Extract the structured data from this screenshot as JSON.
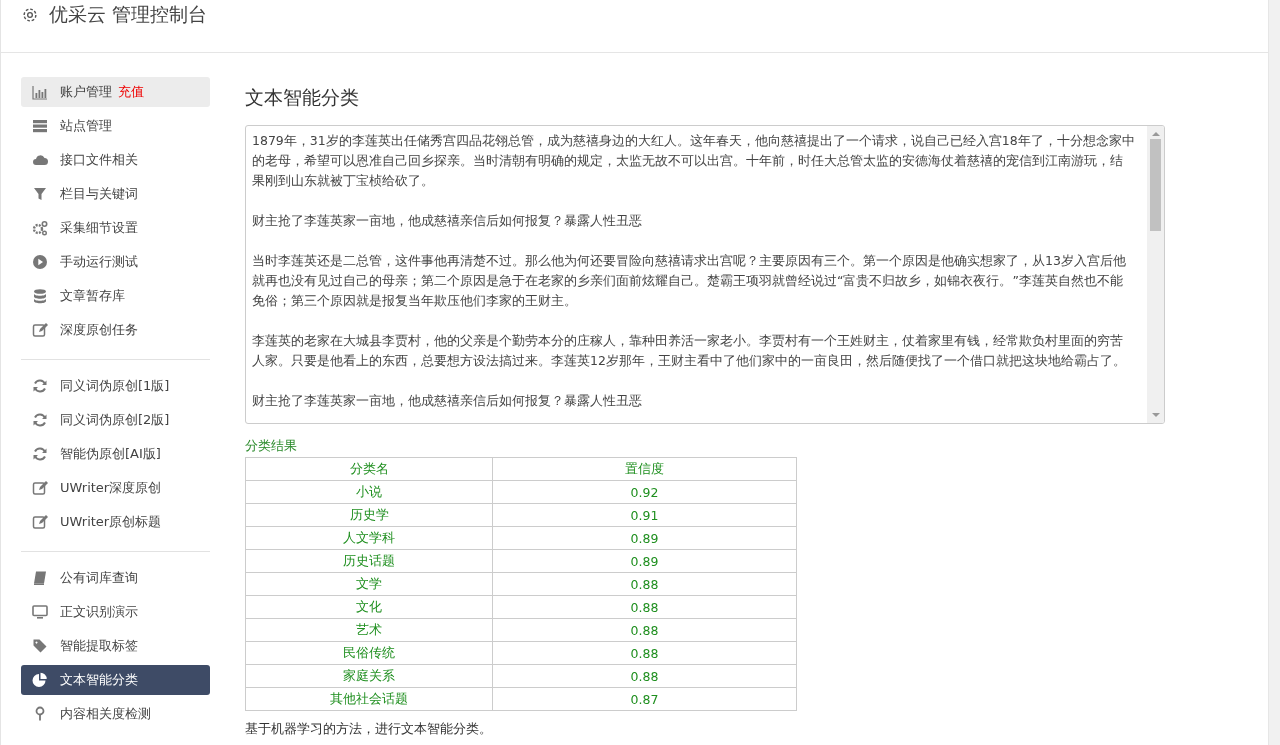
{
  "header": {
    "title": "优采云 管理控制台"
  },
  "sidebar": {
    "groups": [
      {
        "items": [
          {
            "label": "账户管理",
            "badge": "充值",
            "selected": false,
            "hover": true
          },
          {
            "label": "站点管理",
            "selected": false
          },
          {
            "label": "接口文件相关",
            "selected": false
          },
          {
            "label": "栏目与关键词",
            "selected": false
          },
          {
            "label": "采集细节设置",
            "selected": false
          },
          {
            "label": "手动运行测试",
            "selected": false
          },
          {
            "label": "文章暂存库",
            "selected": false
          },
          {
            "label": "深度原创任务",
            "selected": false
          }
        ]
      },
      {
        "items": [
          {
            "label": "同义词伪原创[1版]",
            "selected": false
          },
          {
            "label": "同义词伪原创[2版]",
            "selected": false
          },
          {
            "label": "智能伪原创[AI版]",
            "selected": false
          },
          {
            "label": "UWriter深度原创",
            "selected": false
          },
          {
            "label": "UWriter原创标题",
            "selected": false
          }
        ]
      },
      {
        "items": [
          {
            "label": "公有词库查询",
            "selected": false
          },
          {
            "label": "正文识别演示",
            "selected": false
          },
          {
            "label": "智能提取标签",
            "selected": false
          },
          {
            "label": "文本智能分类",
            "selected": true
          },
          {
            "label": "内容相关度检测",
            "selected": false
          }
        ]
      }
    ]
  },
  "main": {
    "title": "文本智能分类",
    "article": [
      "1879年，31岁的李莲英出任储秀宫四品花翎总管，成为慈禧身边的大红人。这年春天，他向慈禧提出了一个请求，说自己已经入宫18年了，十分想念家中的老母，希望可以恩准自己回乡探亲。当时清朝有明确的规定，太监无故不可以出宫。十年前，时任大总管太监的安德海仗着慈禧的宠信到江南游玩，结果刚到山东就被丁宝桢给砍了。",
      "财主抢了李莲英家一亩地，他成慈禧亲信后如何报复？暴露人性丑恶",
      "当时李莲英还是二总管，这件事他再清楚不过。那么他为何还要冒险向慈禧请求出宫呢？主要原因有三个。第一个原因是他确实想家了，从13岁入宫后他就再也没有见过自己的母亲；第二个原因是急于在老家的乡亲们面前炫耀自己。楚霸王项羽就曾经说过“富贵不归故乡，如锦衣夜行。”李莲英自然也不能免俗；第三个原因就是报复当年欺压他们李家的王财主。",
      "李莲英的老家在大城县李贾村，他的父亲是个勤劳本分的庄稼人，靠种田养活一家老小。李贾村有一个王姓财主，仗着家里有钱，经常欺负村里面的穷苦人家。只要是他看上的东西，总要想方设法搞过来。李莲英12岁那年，王财主看中了他们家中的一亩良田，然后随便找了一个借口就把这块地给霸占了。",
      "财主抢了李莲英家一亩地，他成慈禧亲信后如何报复？暴露人性丑恶"
    ],
    "result_label": "分类结果",
    "table": {
      "columns": [
        "分类名",
        "置信度"
      ],
      "rows": [
        [
          "小说",
          "0.92"
        ],
        [
          "历史学",
          "0.91"
        ],
        [
          "人文学科",
          "0.89"
        ],
        [
          "历史话题",
          "0.89"
        ],
        [
          "文学",
          "0.88"
        ],
        [
          "文化",
          "0.88"
        ],
        [
          "艺术",
          "0.88"
        ],
        [
          "民俗传统",
          "0.88"
        ],
        [
          "家庭关系",
          "0.88"
        ],
        [
          "其他社会话题",
          "0.87"
        ]
      ]
    },
    "footnote": "基于机器学习的方法，进行文本智能分类。"
  }
}
